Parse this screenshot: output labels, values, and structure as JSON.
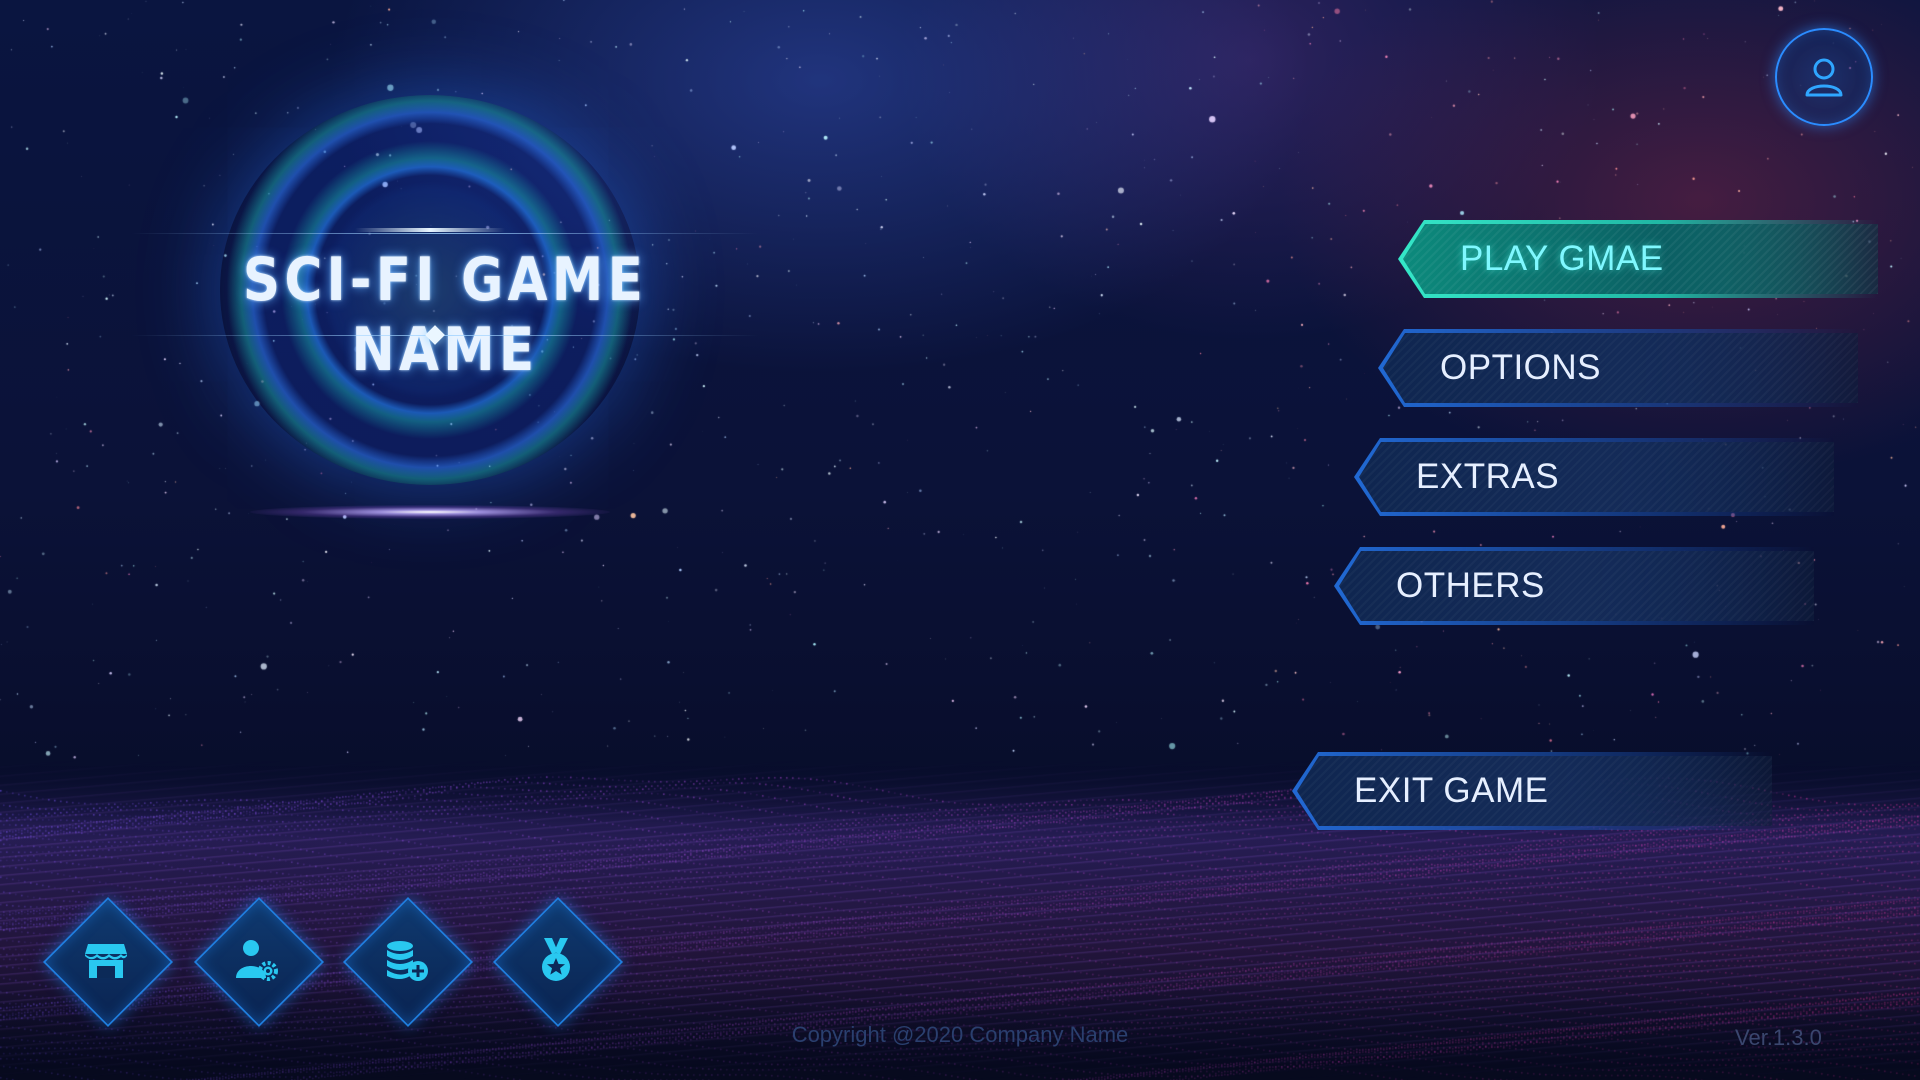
{
  "game": {
    "title": "SCI-FI GAME NAME"
  },
  "profile": {
    "icon": "user-profile-icon"
  },
  "menu": {
    "items": [
      {
        "label": "PLAY GMAE",
        "active": true
      },
      {
        "label": "OPTIONS",
        "active": false
      },
      {
        "label": "EXTRAS",
        "active": false
      },
      {
        "label": "OTHERS",
        "active": false
      }
    ],
    "exit": {
      "label": "EXIT GAME"
    }
  },
  "dock": {
    "items": [
      {
        "name": "shop",
        "icon": "storefront-icon"
      },
      {
        "name": "account-settings",
        "icon": "user-gear-icon"
      },
      {
        "name": "coins",
        "icon": "coin-stack-add-icon"
      },
      {
        "name": "achievements",
        "icon": "medal-star-icon"
      }
    ]
  },
  "footer": {
    "copyright": "Copyright @2020 Company Name",
    "version": "Ver.1.3.0"
  },
  "colors": {
    "accent_cyan": "#35e7c8",
    "accent_blue": "#2b8cff",
    "icon_color": "#29c8f0",
    "background": "#0a1540"
  }
}
